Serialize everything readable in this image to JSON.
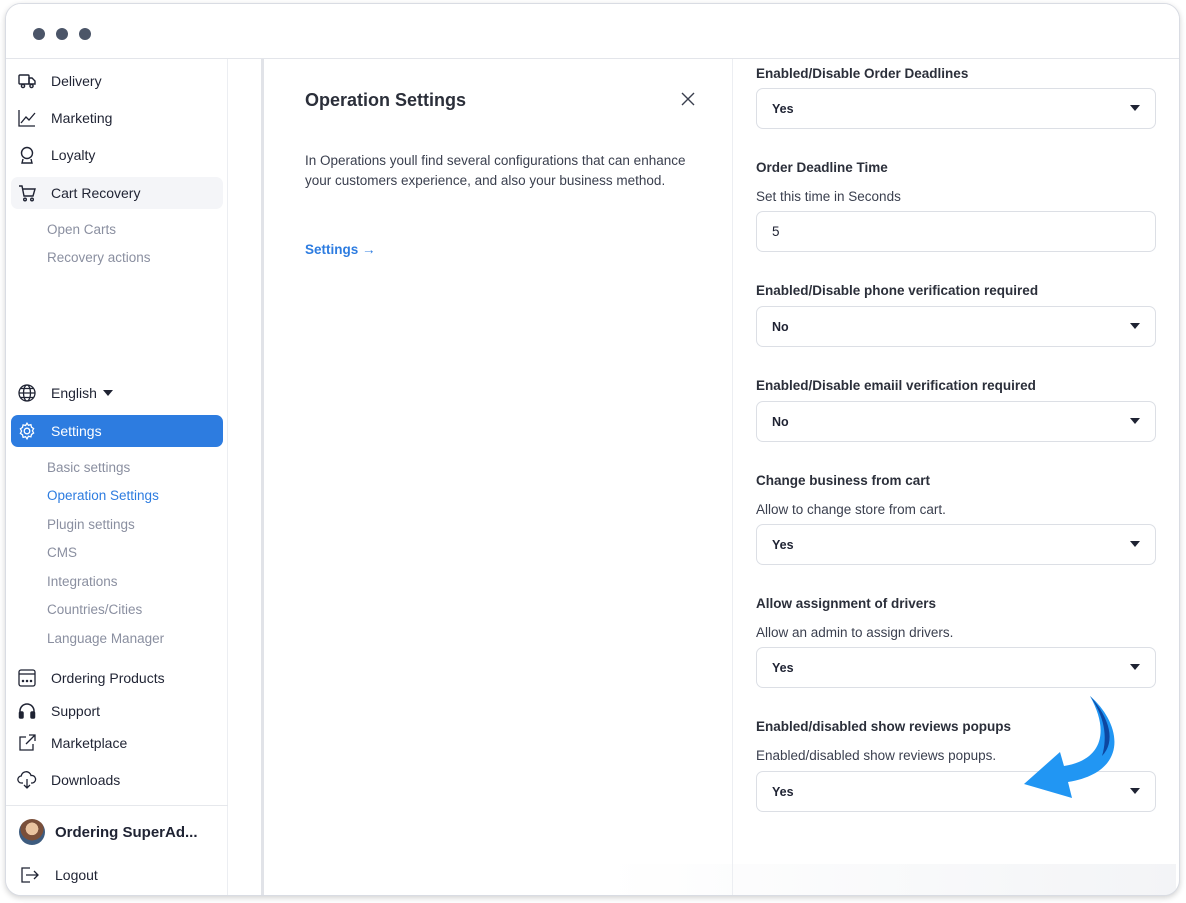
{
  "window": {
    "dots": 3
  },
  "sidebar": {
    "top_items": [
      {
        "label": "Delivery",
        "icon": "truck-icon"
      },
      {
        "label": "Marketing",
        "icon": "chart-line-icon"
      },
      {
        "label": "Loyalty",
        "icon": "award-icon"
      },
      {
        "label": "Cart Recovery",
        "icon": "cart-icon"
      }
    ],
    "cart_recovery_sub": [
      "Open Carts",
      "Recovery actions"
    ],
    "language": {
      "label": "English",
      "icon": "globe-icon"
    },
    "settings": {
      "label": "Settings",
      "icon": "gear-icon"
    },
    "settings_sub": [
      "Basic settings",
      "Operation Settings",
      "Plugin settings",
      "CMS",
      "Integrations",
      "Countries/Cities",
      "Language Manager"
    ],
    "bottom_items": [
      {
        "label": "Ordering Products",
        "icon": "window-icon"
      },
      {
        "label": "Support",
        "icon": "headset-icon"
      },
      {
        "label": "Marketplace",
        "icon": "external-link-icon"
      },
      {
        "label": "Downloads",
        "icon": "cloud-download-icon"
      }
    ],
    "user": {
      "name": "Ordering SuperAd..."
    },
    "logout": {
      "label": "Logout",
      "icon": "logout-icon"
    }
  },
  "info_panel": {
    "title": "Operation Settings",
    "description": "In Operations youll find several configurations that can enhance your customers experience, and also your business method.",
    "link": "Settings →"
  },
  "form": {
    "order_deadlines": {
      "label": "Enabled/Disable Order Deadlines",
      "value": "Yes"
    },
    "deadline_time": {
      "label": "Order Deadline Time",
      "hint": "Set this time in Seconds",
      "value": "5"
    },
    "phone_verification": {
      "label": "Enabled/Disable phone verification required",
      "value": "No"
    },
    "email_verification": {
      "label": "Enabled/Disable emaiil verification required",
      "value": "No"
    },
    "change_business": {
      "label": "Change business from cart",
      "hint": "Allow to change store from cart.",
      "value": "Yes"
    },
    "assign_drivers": {
      "label": "Allow assignment of drivers",
      "hint": "Allow an admin to assign drivers.",
      "value": "Yes"
    },
    "reviews_popups": {
      "label": "Enabled/disabled show reviews popups",
      "hint": "Enabled/disabled show reviews popups.",
      "value": "Yes"
    }
  },
  "colors": {
    "accent": "#2d7ce0",
    "arrow": "#2196f3",
    "arrow_dark": "#0d47a1"
  }
}
